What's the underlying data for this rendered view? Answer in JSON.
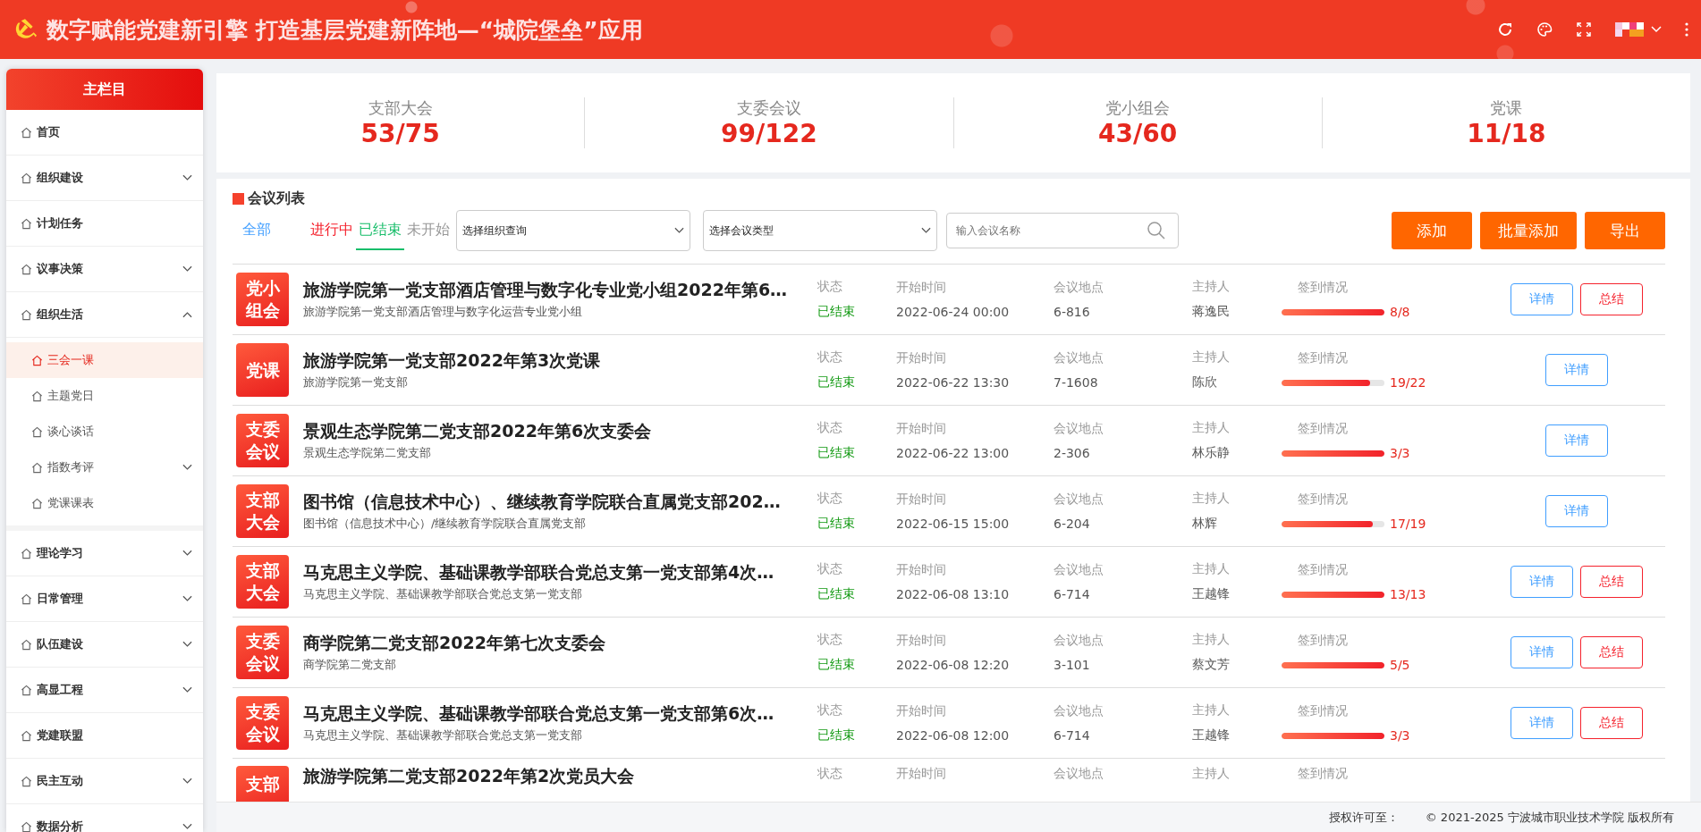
{
  "header": {
    "title": "数字赋能党建新引擎 打造基层党建新阵地—“城院堡垒”应用"
  },
  "sidebar": {
    "title": "主栏目",
    "items": [
      {
        "label": "首页",
        "selected": false
      },
      {
        "label": "组织建设",
        "selected": false,
        "expanded": false
      },
      {
        "label": "计划任务",
        "selected": false
      },
      {
        "label": "议事决策",
        "selected": false,
        "expanded": false
      },
      {
        "label": "组织生活",
        "selected": false,
        "expanded": true,
        "children": [
          {
            "label": "三会一课",
            "selected": true
          },
          {
            "label": "主题党日",
            "selected": false
          },
          {
            "label": "谈心谈话",
            "selected": false
          },
          {
            "label": "指数考评",
            "selected": false,
            "expanded": false
          },
          {
            "label": "党课课表",
            "selected": false
          }
        ]
      },
      {
        "label": "理论学习",
        "selected": false,
        "expanded": false
      },
      {
        "label": "日常管理",
        "selected": false,
        "expanded": false
      },
      {
        "label": "队伍建设",
        "selected": false,
        "expanded": false
      },
      {
        "label": "高显工程",
        "selected": false,
        "expanded": false
      },
      {
        "label": "党建联盟",
        "selected": false
      },
      {
        "label": "民主互动",
        "selected": false,
        "expanded": false
      },
      {
        "label": "数据分析",
        "selected": false,
        "expanded": false
      }
    ]
  },
  "stats": [
    {
      "label": "支部大会",
      "value": "53/75"
    },
    {
      "label": "支委会议",
      "value": "99/122"
    },
    {
      "label": "党小组会",
      "value": "43/60"
    },
    {
      "label": "党课",
      "value": "11/18"
    }
  ],
  "meeting_list": {
    "title": "会议列表",
    "filters": [
      {
        "label": "全部",
        "color": "#409eff",
        "selected": false
      },
      {
        "label": "进行中",
        "color": "#f5222d",
        "selected": false
      },
      {
        "label": "已结束",
        "color": "#19be6b",
        "selected": true
      },
      {
        "label": "未开始",
        "color": "#999999",
        "selected": false
      }
    ],
    "org_select": "选择组织查询",
    "type_select": "选择会议类型",
    "search": {
      "placeholder": "输入会议名称"
    },
    "actions": [
      "添加",
      "批量添加",
      "导出"
    ],
    "rows": [
      {
        "badge": "党小组会",
        "title": "旅游学院第一党支部酒店管理与数字化专业党小组2022年第6…",
        "subtitle": "旅游学院第一党支部酒店管理与数字化运营专业党小组",
        "labels": [
          "状态",
          "开始时间",
          "会议地点",
          "主持人",
          "签到情况"
        ],
        "status": "已结束",
        "start": "2022-06-24 00:00",
        "place": "6-816",
        "host": "蒋逸民",
        "level": 1,
        "signin": "8/8",
        "buttons": [
          "详情",
          "总结"
        ]
      },
      {
        "badge": "党课",
        "title": "旅游学院第一党支部2022年第3次党课",
        "subtitle": "旅游学院第一党支部",
        "labels": [
          "状态",
          "开始时间",
          "会议地点",
          "主持人",
          "签到情况"
        ],
        "status": "已结束",
        "start": "2022-06-22 13:30",
        "place": "7-1608",
        "host": "陈欣",
        "level": 0.86,
        "signin": "19/22",
        "buttons": [
          "详情"
        ]
      },
      {
        "badge": "支委会议",
        "title": "景观生态学院第二党支部2022年第6次支委会",
        "subtitle": "景观生态学院第二党支部",
        "labels": [
          "状态",
          "开始时间",
          "会议地点",
          "主持人",
          "签到情况"
        ],
        "status": "已结束",
        "start": "2022-06-22 13:00",
        "place": "2-306",
        "host": "林乐静",
        "level": 1,
        "signin": "3/3",
        "buttons": [
          "详情"
        ]
      },
      {
        "badge": "支部大会",
        "title": "图书馆（信息技术中心）、继续教育学院联合直属党支部202…",
        "subtitle": "图书馆（信息技术中心）/继续教育学院联合直属党支部",
        "labels": [
          "状态",
          "开始时间",
          "会议地点",
          "主持人",
          "签到情况"
        ],
        "status": "已结束",
        "start": "2022-06-15 15:00",
        "place": "6-204",
        "host": "林辉",
        "level": 0.89,
        "signin": "17/19",
        "buttons": [
          "详情"
        ]
      },
      {
        "badge": "支部大会",
        "title": "马克思主义学院、基础课教学部联合党总支第一党支部第4次…",
        "subtitle": "马克思主义学院、基础课教学部联合党总支第一党支部",
        "labels": [
          "状态",
          "开始时间",
          "会议地点",
          "主持人",
          "签到情况"
        ],
        "status": "已结束",
        "start": "2022-06-08 13:10",
        "place": "6-714",
        "host": "王越锋",
        "level": 1,
        "signin": "13/13",
        "buttons": [
          "详情",
          "总结"
        ]
      },
      {
        "badge": "支委会议",
        "title": "商学院第二党支部2022年第七次支委会",
        "subtitle": "商学院第二党支部",
        "labels": [
          "状态",
          "开始时间",
          "会议地点",
          "主持人",
          "签到情况"
        ],
        "status": "已结束",
        "start": "2022-06-08 12:20",
        "place": "3-101",
        "host": "蔡文芳",
        "level": 1,
        "signin": "5/5",
        "buttons": [
          "详情",
          "总结"
        ]
      },
      {
        "badge": "支委会议",
        "title": "马克思主义学院、基础课教学部联合党总支第一党支部第6次…",
        "subtitle": "马克思主义学院、基础课教学部联合党总支第一党支部",
        "labels": [
          "状态",
          "开始时间",
          "会议地点",
          "主持人",
          "签到情况"
        ],
        "status": "已结束",
        "start": "2022-06-08 12:00",
        "place": "6-714",
        "host": "王越锋",
        "level": 1,
        "signin": "3/3",
        "buttons": [
          "详情",
          "总结"
        ]
      },
      {
        "badge": "支部",
        "title": "旅游学院第二党支部2022年第2次党员大会",
        "labels": [
          "状态",
          "开始时间",
          "会议地点",
          "主持人",
          "签到情况"
        ]
      }
    ]
  },
  "footer": {
    "license_label": "授权许可至：",
    "copyright": "© 2021-2025 宁波城市职业技术学院 版权所有"
  }
}
